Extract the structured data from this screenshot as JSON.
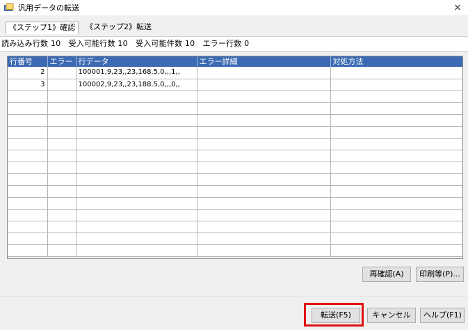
{
  "window": {
    "title": "汎用データの転送",
    "close_glyph": "×",
    "icon": "app-icon"
  },
  "tabs": [
    {
      "label": "《ステップ1》確認",
      "active": true
    },
    {
      "label": "《ステップ2》転送",
      "active": false
    }
  ],
  "summary": "読み込み行数 10　受入可能行数 10　受入可能件数 10　エラー行数 0",
  "grid": {
    "header_color": "#3c6bb3",
    "columns": [
      "行番号",
      "エラー",
      "行データ",
      "エラー詳細",
      "対処方法"
    ],
    "rows": [
      [
        "2",
        "",
        "100001,9,23,,23,168.5,0,,,1,,",
        "",
        ""
      ],
      [
        "3",
        "",
        "100002,9,23,,23,188.5,0,,,0,,",
        "",
        ""
      ],
      [
        "",
        "",
        "",
        "",
        ""
      ],
      [
        "",
        "",
        "",
        "",
        ""
      ],
      [
        "",
        "",
        "",
        "",
        ""
      ],
      [
        "",
        "",
        "",
        "",
        ""
      ],
      [
        "",
        "",
        "",
        "",
        ""
      ],
      [
        "",
        "",
        "",
        "",
        ""
      ],
      [
        "",
        "",
        "",
        "",
        ""
      ],
      [
        "",
        "",
        "",
        "",
        ""
      ],
      [
        "",
        "",
        "",
        "",
        ""
      ],
      [
        "",
        "",
        "",
        "",
        ""
      ],
      [
        "",
        "",
        "",
        "",
        ""
      ],
      [
        "",
        "",
        "",
        "",
        ""
      ],
      [
        "",
        "",
        "",
        "",
        ""
      ],
      [
        "",
        "",
        "",
        "",
        ""
      ]
    ]
  },
  "buttons": {
    "recheck": "再確認(A)",
    "print": "印刷等(P)...",
    "transfer": "転送(F5)",
    "cancel": "キャンセル",
    "help": "ヘルプ(F1)"
  },
  "highlight_color": "#e01010"
}
